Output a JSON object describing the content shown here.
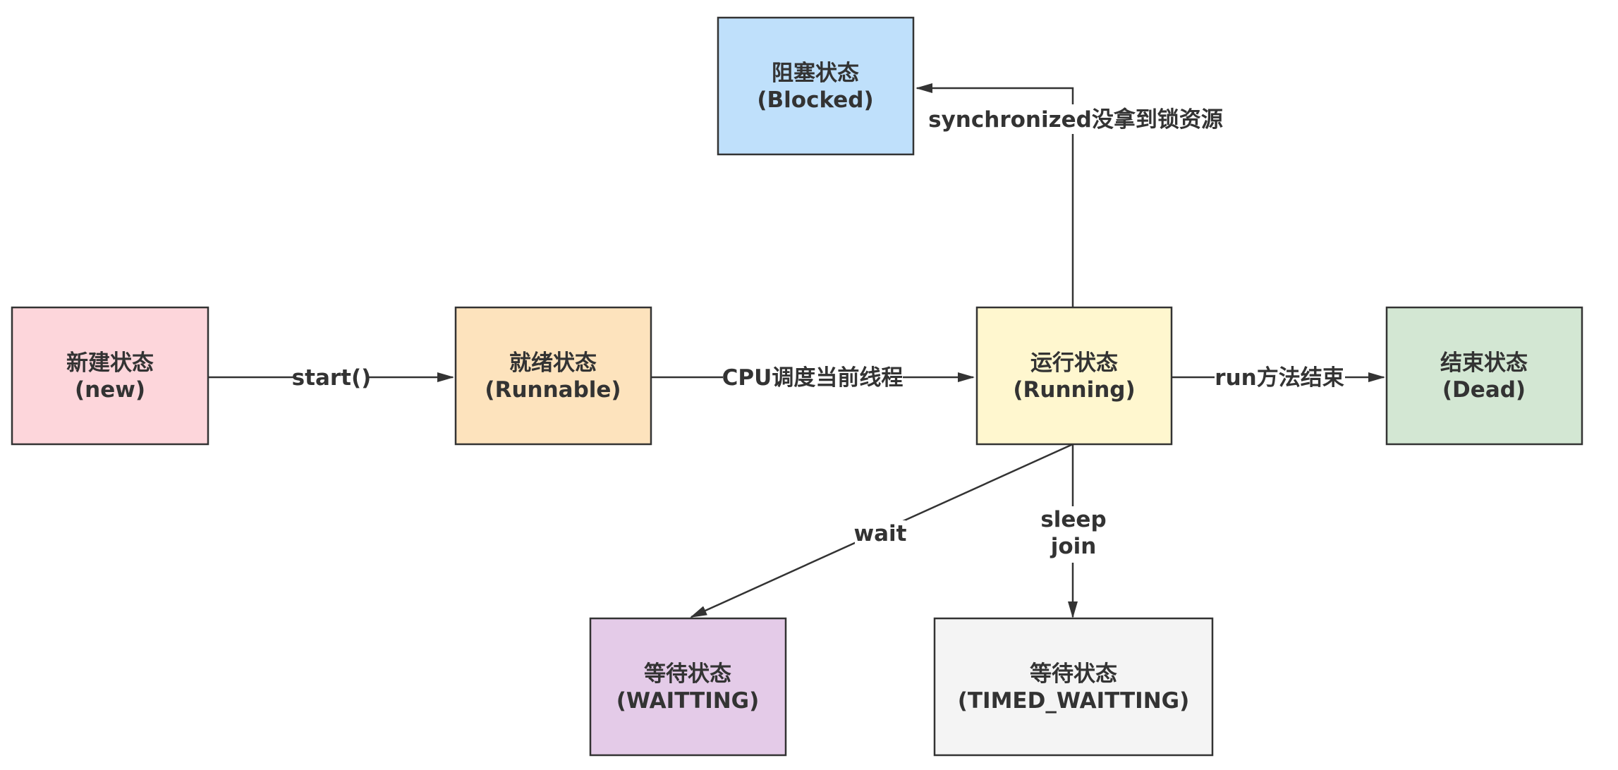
{
  "nodes": {
    "new": {
      "title": "新建状态",
      "subtitle": "(new)",
      "color": "#fdd6db"
    },
    "runnable": {
      "title": "就绪状态",
      "subtitle": "(Runnable)",
      "color": "#fde3bd"
    },
    "running": {
      "title": "运行状态",
      "subtitle": "(Running)",
      "color": "#fff7cf"
    },
    "dead": {
      "title": "结束状态",
      "subtitle": "(Dead)",
      "color": "#d3e7d3"
    },
    "blocked": {
      "title": "阻塞状态",
      "subtitle": "(Blocked)",
      "color": "#bfe0fb"
    },
    "waiting": {
      "title": "等待状态",
      "subtitle": "(WAITTING)",
      "color": "#e4cbe8"
    },
    "timed_waiting": {
      "title": "等待状态",
      "subtitle": "(TIMED_WAITTING)",
      "color": "#f4f4f4"
    }
  },
  "edges": {
    "start": {
      "label": "start()"
    },
    "cpu_schedule": {
      "label": "CPU调度当前线程"
    },
    "run_end": {
      "label": "run方法结束"
    },
    "synchronized": {
      "label": "synchronized没拿到锁资源"
    },
    "wait": {
      "label": "wait"
    },
    "sleep_join": {
      "line1": "sleep",
      "line2": "join"
    }
  }
}
